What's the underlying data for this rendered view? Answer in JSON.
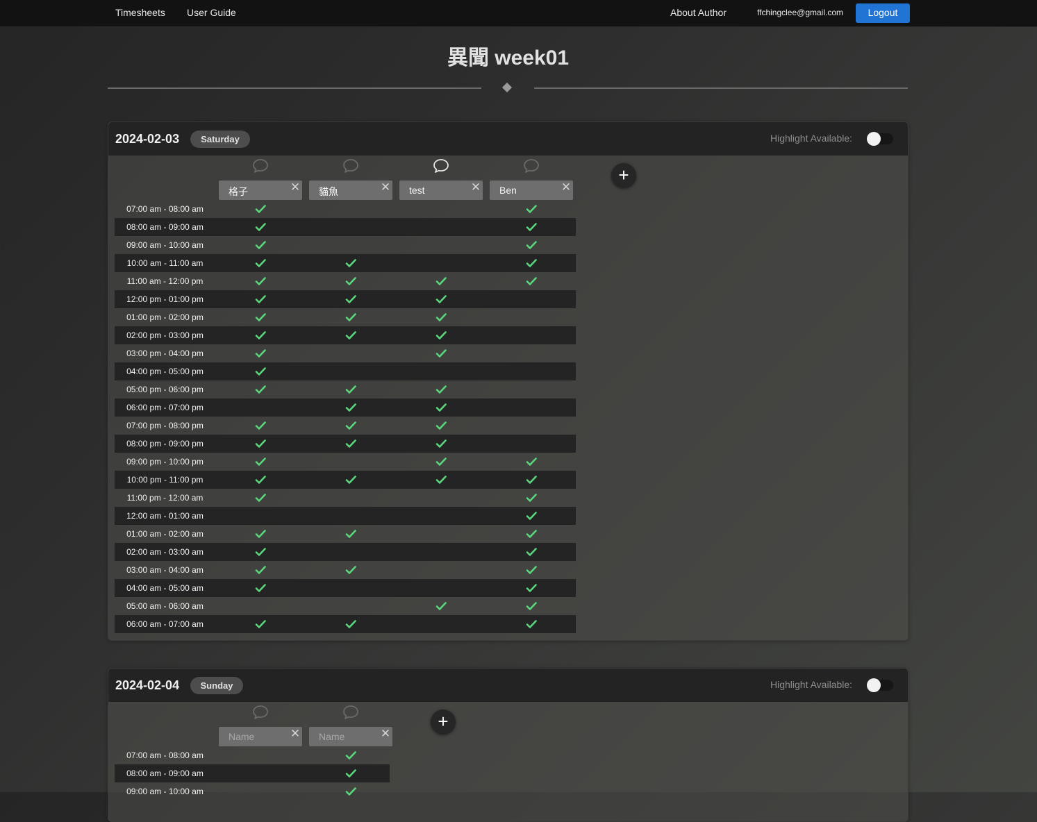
{
  "nav": {
    "timesheets": "Timesheets",
    "user_guide": "User Guide",
    "about_author": "About Author",
    "email": "ffchingclee@gmail.com",
    "logout": "Logout"
  },
  "page": {
    "title": "異聞 week01"
  },
  "colors": {
    "accent": "#1f74d4",
    "check": "#5ad67d"
  },
  "icons": {
    "comment": "comment-bubble-icon",
    "close": "close-icon",
    "add": "plus-icon",
    "check": "check-icon"
  },
  "days": [
    {
      "date": "2024-02-03",
      "weekday": "Saturday",
      "highlight_label": "Highlight Available:",
      "highlight_on": false,
      "members": [
        "格子",
        "貓魚",
        "test",
        "Ben"
      ],
      "name_placeholder": "Name",
      "slots": [
        {
          "time": "07:00 am - 08:00 am",
          "avail": [
            true,
            false,
            false,
            true
          ]
        },
        {
          "time": "08:00 am - 09:00 am",
          "avail": [
            true,
            false,
            false,
            true
          ]
        },
        {
          "time": "09:00 am - 10:00 am",
          "avail": [
            true,
            false,
            false,
            true
          ]
        },
        {
          "time": "10:00 am - 11:00 am",
          "avail": [
            true,
            true,
            false,
            true
          ]
        },
        {
          "time": "11:00 am - 12:00 pm",
          "avail": [
            true,
            true,
            true,
            true
          ]
        },
        {
          "time": "12:00 pm - 01:00 pm",
          "avail": [
            true,
            true,
            true,
            false
          ]
        },
        {
          "time": "01:00 pm - 02:00 pm",
          "avail": [
            true,
            true,
            true,
            false
          ]
        },
        {
          "time": "02:00 pm - 03:00 pm",
          "avail": [
            true,
            true,
            true,
            false
          ]
        },
        {
          "time": "03:00 pm - 04:00 pm",
          "avail": [
            true,
            false,
            true,
            false
          ]
        },
        {
          "time": "04:00 pm - 05:00 pm",
          "avail": [
            true,
            false,
            false,
            false
          ]
        },
        {
          "time": "05:00 pm - 06:00 pm",
          "avail": [
            true,
            true,
            true,
            false
          ]
        },
        {
          "time": "06:00 pm - 07:00 pm",
          "avail": [
            false,
            true,
            true,
            false
          ]
        },
        {
          "time": "07:00 pm - 08:00 pm",
          "avail": [
            true,
            true,
            true,
            false
          ]
        },
        {
          "time": "08:00 pm - 09:00 pm",
          "avail": [
            true,
            true,
            true,
            false
          ]
        },
        {
          "time": "09:00 pm - 10:00 pm",
          "avail": [
            true,
            false,
            true,
            true
          ]
        },
        {
          "time": "10:00 pm - 11:00 pm",
          "avail": [
            true,
            true,
            true,
            true
          ]
        },
        {
          "time": "11:00 pm - 12:00 am",
          "avail": [
            true,
            false,
            false,
            true
          ]
        },
        {
          "time": "12:00 am - 01:00 am",
          "avail": [
            false,
            false,
            false,
            true
          ]
        },
        {
          "time": "01:00 am - 02:00 am",
          "avail": [
            true,
            true,
            false,
            true
          ]
        },
        {
          "time": "02:00 am - 03:00 am",
          "avail": [
            true,
            false,
            false,
            true
          ]
        },
        {
          "time": "03:00 am - 04:00 am",
          "avail": [
            true,
            true,
            false,
            true
          ]
        },
        {
          "time": "04:00 am - 05:00 am",
          "avail": [
            true,
            false,
            false,
            true
          ]
        },
        {
          "time": "05:00 am - 06:00 am",
          "avail": [
            false,
            false,
            true,
            true
          ]
        },
        {
          "time": "06:00 am - 07:00 am",
          "avail": [
            true,
            true,
            false,
            true
          ]
        }
      ]
    },
    {
      "date": "2024-02-04",
      "weekday": "Sunday",
      "highlight_label": "Highlight Available:",
      "highlight_on": false,
      "members": [
        "",
        ""
      ],
      "name_placeholder": "Name",
      "slots": [
        {
          "time": "07:00 am - 08:00 am",
          "avail": [
            false,
            true
          ]
        },
        {
          "time": "08:00 am - 09:00 am",
          "avail": [
            false,
            true
          ]
        },
        {
          "time": "09:00 am - 10:00 am",
          "avail": [
            false,
            true
          ]
        }
      ]
    }
  ]
}
